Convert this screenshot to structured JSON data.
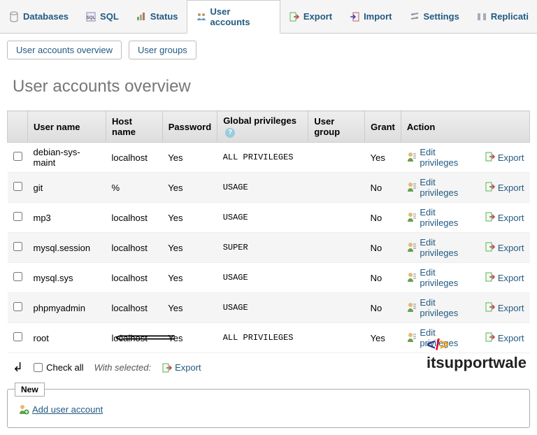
{
  "topTabs": {
    "databases": "Databases",
    "sql": "SQL",
    "status": "Status",
    "userAccounts": "User accounts",
    "export": "Export",
    "import": "Import",
    "settings": "Settings",
    "replication": "Replicati"
  },
  "subTabs": {
    "overview": "User accounts overview",
    "groups": "User groups"
  },
  "pageTitle": "User accounts overview",
  "table": {
    "headers": {
      "userName": "User name",
      "hostName": "Host name",
      "password": "Password",
      "globalPrivileges": "Global privileges",
      "userGroup": "User group",
      "grant": "Grant",
      "action": "Action"
    },
    "rows": [
      {
        "user": "debian-sys-maint",
        "host": "localhost",
        "password": "Yes",
        "priv": "ALL PRIVILEGES",
        "group": "",
        "grant": "Yes"
      },
      {
        "user": "git",
        "host": "%",
        "password": "Yes",
        "priv": "USAGE",
        "group": "",
        "grant": "No"
      },
      {
        "user": "mp3",
        "host": "localhost",
        "password": "Yes",
        "priv": "USAGE",
        "group": "",
        "grant": "No"
      },
      {
        "user": "mysql.session",
        "host": "localhost",
        "password": "Yes",
        "priv": "SUPER",
        "group": "",
        "grant": "No"
      },
      {
        "user": "mysql.sys",
        "host": "localhost",
        "password": "Yes",
        "priv": "USAGE",
        "group": "",
        "grant": "No"
      },
      {
        "user": "phpmyadmin",
        "host": "localhost",
        "password": "Yes",
        "priv": "USAGE",
        "group": "",
        "grant": "No"
      },
      {
        "user": "root",
        "host": "localhost",
        "password": "Yes",
        "priv": "ALL PRIVILEGES",
        "group": "",
        "grant": "Yes"
      }
    ],
    "actions": {
      "editPrivileges": "Edit privileges",
      "export": "Export"
    }
  },
  "footer": {
    "checkAll": "Check all",
    "withSelected": "With selected:",
    "export": "Export"
  },
  "newSection": {
    "legend": "New",
    "addUser": "Add user account"
  },
  "watermark": "itsupportwale"
}
